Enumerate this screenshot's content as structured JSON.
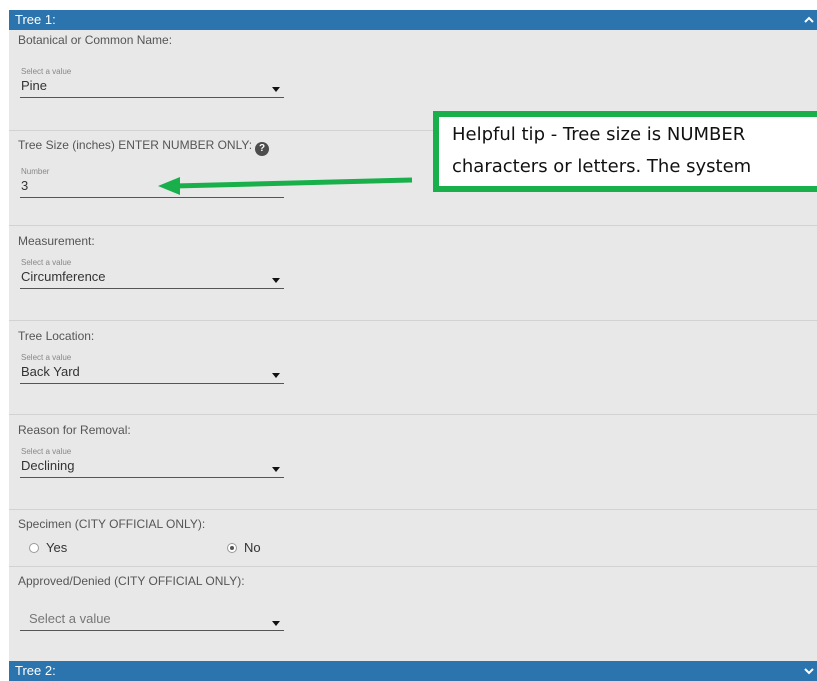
{
  "tree1": {
    "header": "Tree 1:",
    "collapse_icon": "chevron-up-icon",
    "name_field": {
      "label": "Botanical or Common Name:",
      "hint": "Select a value",
      "value": "Pine"
    },
    "size_field": {
      "label": "Tree Size (inches) ENTER NUMBER ONLY:",
      "help_icon_glyph": "?",
      "hint": "Number",
      "value": "3"
    },
    "measurement_field": {
      "label": "Measurement:",
      "hint": "Select a value",
      "value": "Circumference"
    },
    "location_field": {
      "label": "Tree Location:",
      "hint": "Select a value",
      "value": "Back Yard"
    },
    "reason_field": {
      "label": "Reason for Removal:",
      "hint": "Select a value",
      "value": "Declining"
    },
    "specimen_field": {
      "label": "Specimen (CITY OFFICIAL ONLY):",
      "options": [
        "Yes",
        "No"
      ],
      "selected": "No"
    },
    "approval_field": {
      "label": "Approved/Denied (CITY OFFICIAL ONLY):",
      "placeholder": "Select a value"
    }
  },
  "tree2": {
    "header": "Tree 2:",
    "expand_icon": "chevron-down-icon"
  },
  "tip": {
    "line1": "Helpful tip - Tree size is NUMBER",
    "line2": "characters or letters. The system"
  },
  "colors": {
    "header_bg": "#2b74ad",
    "panel_bg": "#e8e8e8",
    "tip_border": "#19b04b",
    "arrow": "#19b04b"
  }
}
